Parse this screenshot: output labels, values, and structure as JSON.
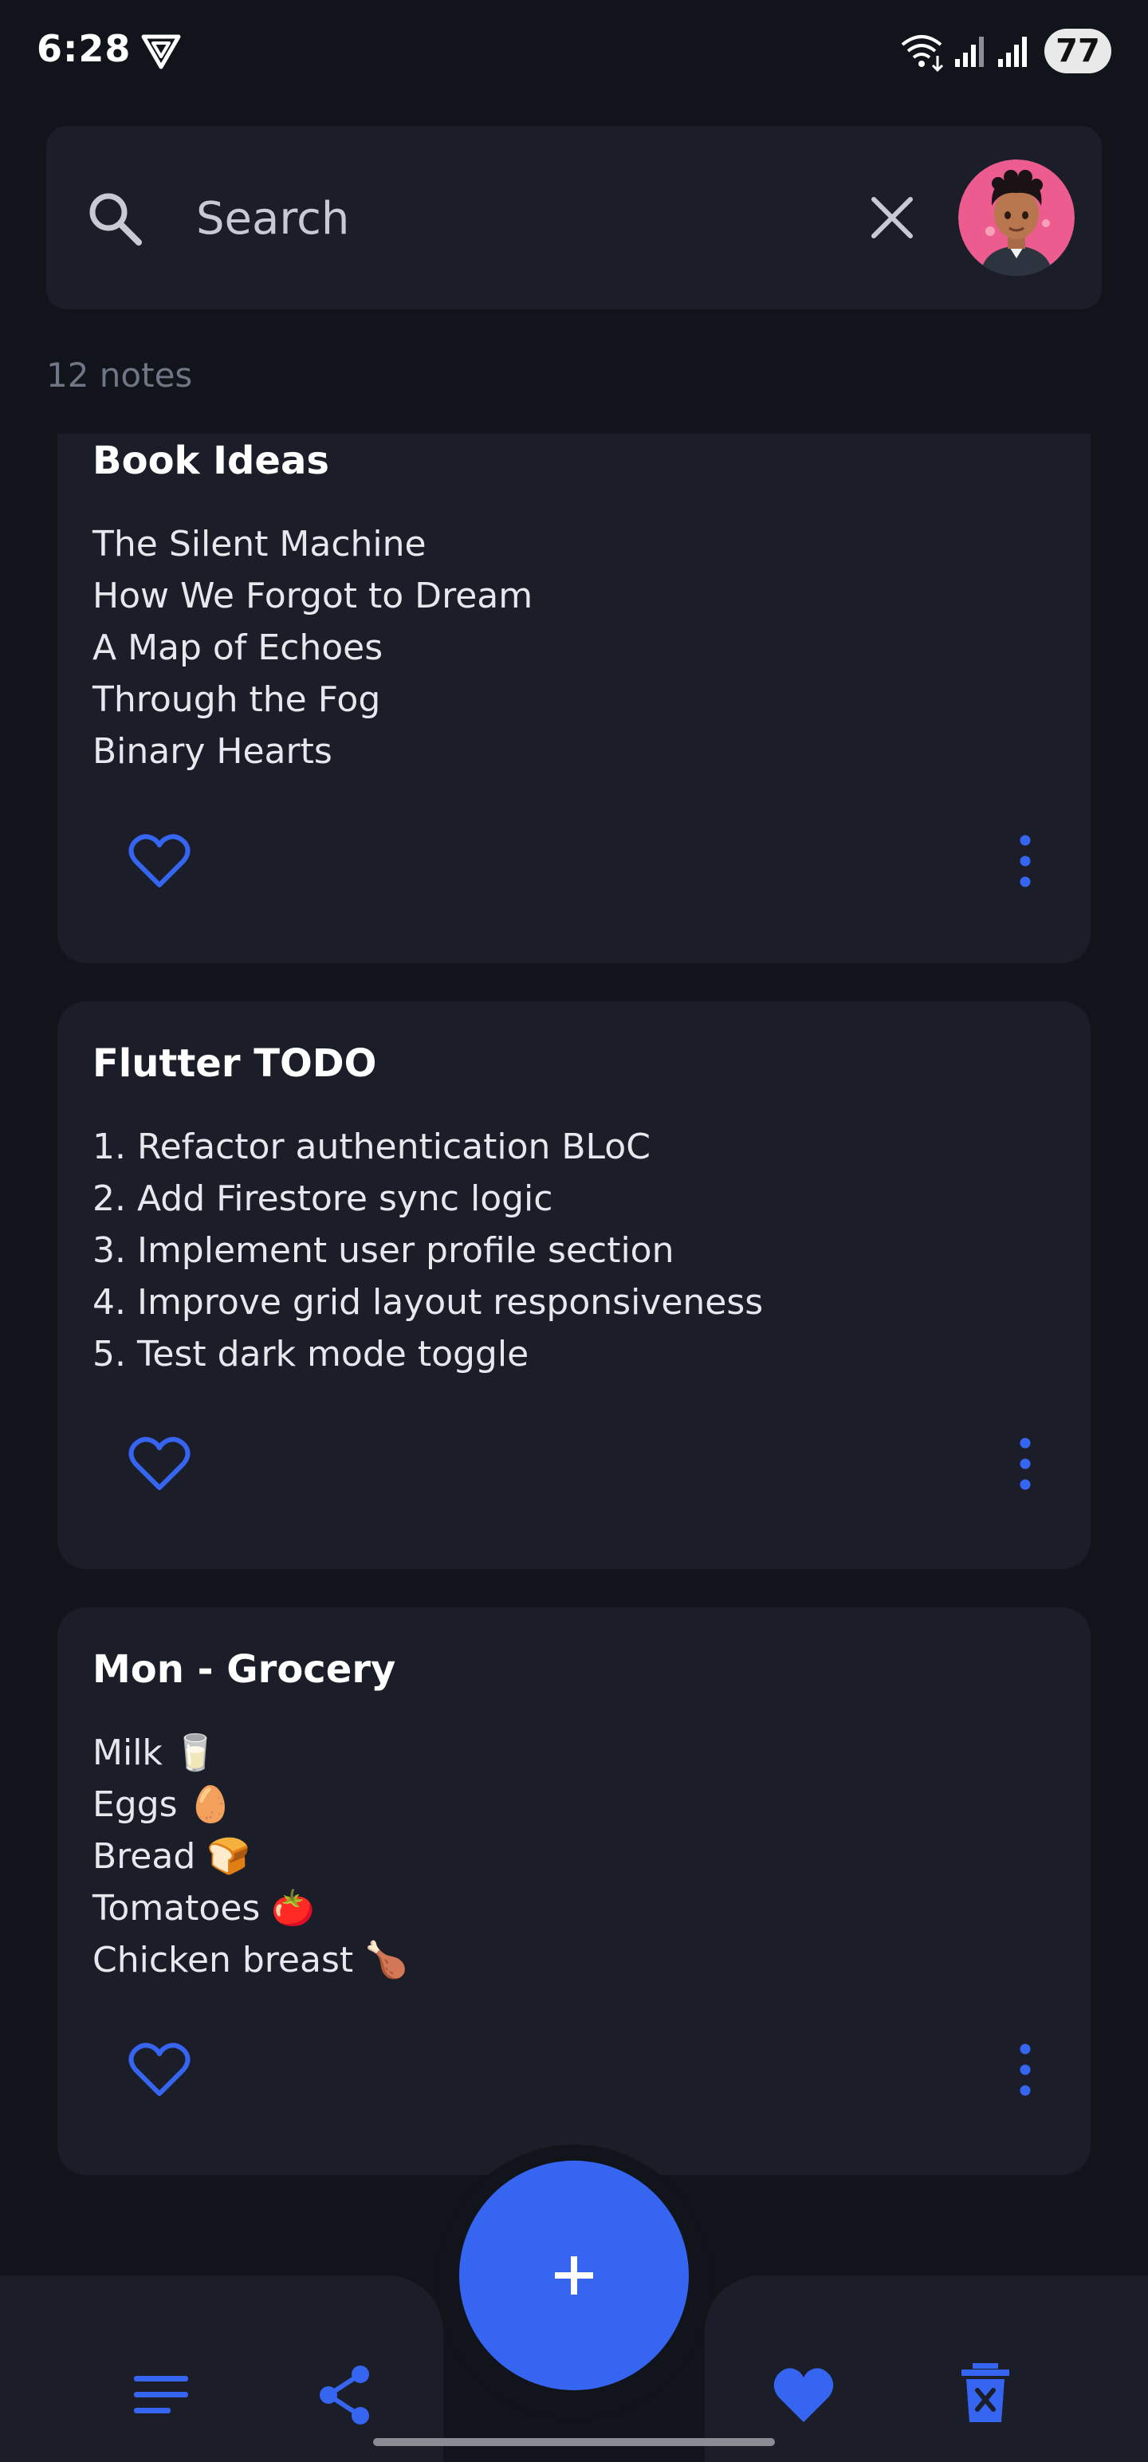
{
  "status_bar": {
    "time": "6:28",
    "battery": "77",
    "icons": [
      "vpn-icon",
      "wifi-icon",
      "signal-icon",
      "signal-icon",
      "battery-icon"
    ]
  },
  "search": {
    "placeholder": "Search",
    "value": "",
    "icons": [
      "search-icon",
      "close-icon",
      "avatar"
    ]
  },
  "notes_count": "12 notes",
  "notes": [
    {
      "title": "Book Ideas",
      "lines": [
        "The Silent Machine",
        "How We Forgot to Dream",
        "A Map of Echoes",
        "Through the Fog",
        "Binary Hearts"
      ],
      "favorite": false
    },
    {
      "title": "Flutter TODO",
      "lines": [
        "1. Refactor authentication BLoC",
        "2. Add Firestore sync logic",
        "3. Implement user profile section",
        "4. Improve grid layout responsiveness",
        "5. Test dark mode toggle"
      ],
      "favorite": false
    },
    {
      "title": "Mon - Grocery",
      "lines": [
        "Milk 🥛",
        "Eggs 🥚",
        "Bread 🍞",
        "Tomatoes 🍅",
        "Chicken breast 🍗"
      ],
      "favorite": false
    }
  ],
  "bottom_nav": {
    "items": [
      "notes-list-icon",
      "share-icon",
      "add-icon",
      "heart-filled-icon",
      "delete-icon"
    ]
  },
  "colors": {
    "background": "#11141b",
    "surface": "#1b1e28",
    "accent": "#3565f1",
    "muted_text": "#6f7784"
  }
}
